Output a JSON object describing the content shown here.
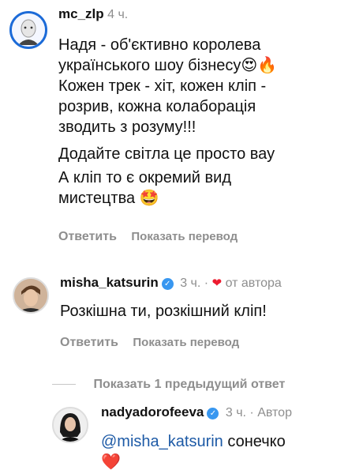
{
  "comments": [
    {
      "username": "mc_zlp",
      "time": "4 ч.",
      "lines": [
        "Надя - об'єктивно королева",
        "українського шоу бізнесу😍🔥",
        "Кожен трек - хіт, кожен кліп -",
        "розрив, кожна колаборація",
        "зводить з розуму!!!",
        "Додайте світла це просто вау",
        "А кліп то є окремий вид",
        "мистецтва 🤩"
      ],
      "reply_label": "Ответить",
      "translate_label": "Показать перевод"
    },
    {
      "username": "misha_katsurin",
      "time": "3 ч.",
      "author_badge": "от автора",
      "text": "Розкішна ти, розкішний кліп!",
      "reply_label": "Ответить",
      "translate_label": "Показать перевод"
    }
  ],
  "show_previous": "Показать 1 предыдущий ответ",
  "reply": {
    "username": "nadyadorofeeva",
    "time": "3 ч.",
    "author_label": "Автор",
    "mention": "@misha_katsurin",
    "text": " сонечко",
    "emoji": "❤️"
  }
}
